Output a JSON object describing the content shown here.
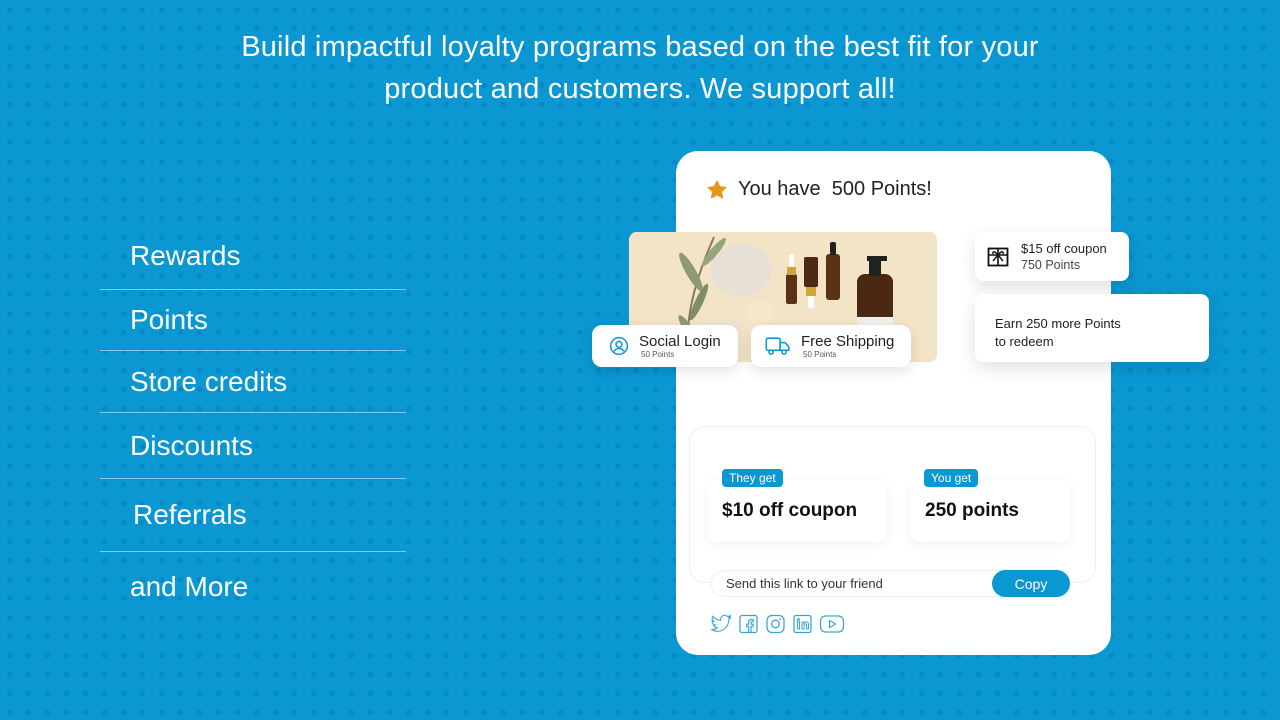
{
  "headline": {
    "line1": "Build impactful loyalty programs based on the best fit for your",
    "line2": "product and customers. We support all!"
  },
  "features": [
    {
      "label": "Rewards"
    },
    {
      "label": "Points"
    },
    {
      "label": "Store credits"
    },
    {
      "label": "Discounts"
    },
    {
      "label": "Referrals"
    },
    {
      "label": "and More"
    }
  ],
  "widget": {
    "points_banner": "You have  500 Points!",
    "earn_actions": [
      {
        "title": "Social Login",
        "points": "50 Points",
        "icon": "user-circle-icon"
      },
      {
        "title": "Free Shipping",
        "points": "50 Points",
        "icon": "truck-icon"
      }
    ],
    "reward": {
      "title": "$15 off coupon",
      "points": "750 Points",
      "icon": "gift-icon"
    },
    "earn_more": {
      "line1": "Earn 250 more Points",
      "line2": "to redeem"
    },
    "referral": {
      "they_tag": "They get",
      "they_value": "$10 off coupon",
      "you_tag": "You get",
      "you_value": "250 points",
      "link_placeholder": "Send this link to your friend",
      "copy_label": "Copy"
    },
    "socials": [
      "twitter-icon",
      "facebook-icon",
      "instagram-icon",
      "linkedin-icon",
      "youtube-icon"
    ]
  },
  "colors": {
    "background": "#0a97d2",
    "accent": "#0a97d2",
    "star": "#e8951d",
    "card": "#ffffff"
  }
}
